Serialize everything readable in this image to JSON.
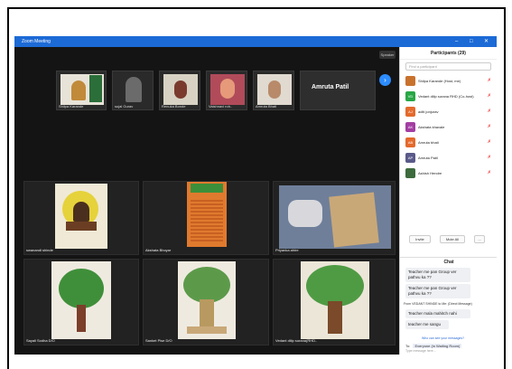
{
  "window": {
    "title": "Zoom Meeting"
  },
  "view_button": "Speaker",
  "strip": [
    {
      "name": "Shilpa Karande"
    },
    {
      "name": "sujal Gurav"
    },
    {
      "name": "Renuka Bonde"
    },
    {
      "name": "Vaishnavi roh.."
    },
    {
      "name": "Amruta Bhati"
    }
  ],
  "strip_highlight": "Amruta Patil",
  "gallery": [
    {
      "name": "swanandi shinde"
    },
    {
      "name": "Akshata Bhoyar"
    },
    {
      "name": "Priyanka ahire"
    },
    {
      "name": "Sayali Sodha D/O"
    },
    {
      "name": "Sanket Pise D/O"
    },
    {
      "name": "Vedant dilip surana(RHD.."
    }
  ],
  "participants": {
    "title": "Participants (29)",
    "search_placeholder": "Find a participant",
    "list": [
      {
        "initials": "",
        "name": "Shilpa Karande (Host, me)",
        "color": "#c9722e"
      },
      {
        "initials": "VD",
        "name": "Vedant dilip surana RHD (Co-host)",
        "color": "#28a745"
      },
      {
        "initials": "AJ",
        "name": "aditi jonjurav",
        "color": "#e46a2c"
      },
      {
        "initials": "AK",
        "name": "Akshata khavale",
        "color": "#a33ea3"
      },
      {
        "initials": "AB",
        "name": "Amruta bhati",
        "color": "#e46a2c"
      },
      {
        "initials": "AP",
        "name": "Amruta Patil",
        "color": "#5a5a8a"
      },
      {
        "initials": "",
        "name": "Ashish Hendre",
        "color": "#3d6b3d"
      }
    ],
    "invite_label": "Invite",
    "mute_all_label": "Mute All",
    "more_label": "..."
  },
  "chat": {
    "title": "Chat",
    "messages": [
      {
        "text": "Teacher me pan Group ver pathvu ka ??"
      },
      {
        "text": "Teacher me pan Group ver pathvu ka ??"
      }
    ],
    "system": "From VEDANT SHINDE to Me: (Direct Message)",
    "messages2": [
      {
        "text": "Teacher mala mahitch nahi"
      },
      {
        "text": "teacher me sangu"
      }
    ],
    "who_can_see": "Who can see your messages?",
    "to_label": "To:",
    "to_value": "Everyone (in Waiting Room)",
    "input_placeholder": "Type message here..."
  }
}
